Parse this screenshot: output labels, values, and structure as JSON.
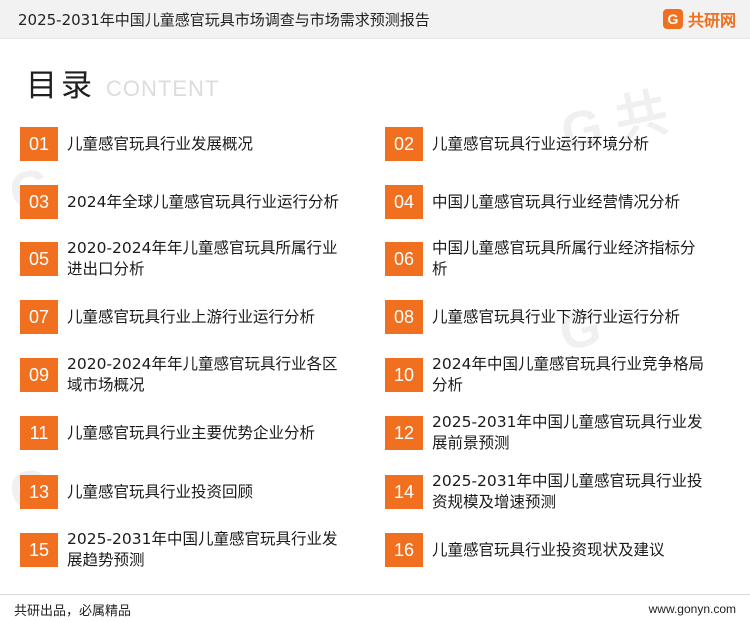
{
  "header": {
    "title": "2025-2031年中国儿童感官玩具市场调查与市场需求预测报告",
    "logo_mark": "G",
    "logo_text": "共研网"
  },
  "heading": {
    "cn": "目录",
    "en": "CONTENT"
  },
  "toc": [
    {
      "num": "01",
      "label": "儿童感官玩具行业发展概况"
    },
    {
      "num": "02",
      "label": "儿童感官玩具行业运行环境分析"
    },
    {
      "num": "03",
      "label": "2024年全球儿童感官玩具行业运行分析"
    },
    {
      "num": "04",
      "label": "中国儿童感官玩具行业经营情况分析"
    },
    {
      "num": "05",
      "label": "2020-2024年年儿童感官玩具所属行业进出口分析"
    },
    {
      "num": "06",
      "label": "中国儿童感官玩具所属行业经济指标分析"
    },
    {
      "num": "07",
      "label": "儿童感官玩具行业上游行业运行分析"
    },
    {
      "num": "08",
      "label": "儿童感官玩具行业下游行业运行分析"
    },
    {
      "num": "09",
      "label": "2020-2024年年儿童感官玩具行业各区域市场概况"
    },
    {
      "num": "10",
      "label": "2024年中国儿童感官玩具行业竞争格局分析"
    },
    {
      "num": "11",
      "label": "儿童感官玩具行业主要优势企业分析"
    },
    {
      "num": "12",
      "label": "2025-2031年中国儿童感官玩具行业发展前景预测"
    },
    {
      "num": "13",
      "label": "儿童感官玩具行业投资回顾"
    },
    {
      "num": "14",
      "label": "2025-2031年中国儿童感官玩具行业投资规模及增速预测"
    },
    {
      "num": "15",
      "label": "2025-2031年中国儿童感官玩具行业发展趋势预测"
    },
    {
      "num": "16",
      "label": "儿童感官玩具行业投资现状及建议"
    }
  ],
  "footer": {
    "slogan": "共研出品，必属精品",
    "url": "www.gonyn.com"
  },
  "colors": {
    "accent": "#f07020",
    "header_bg": "#f2f2f2"
  }
}
